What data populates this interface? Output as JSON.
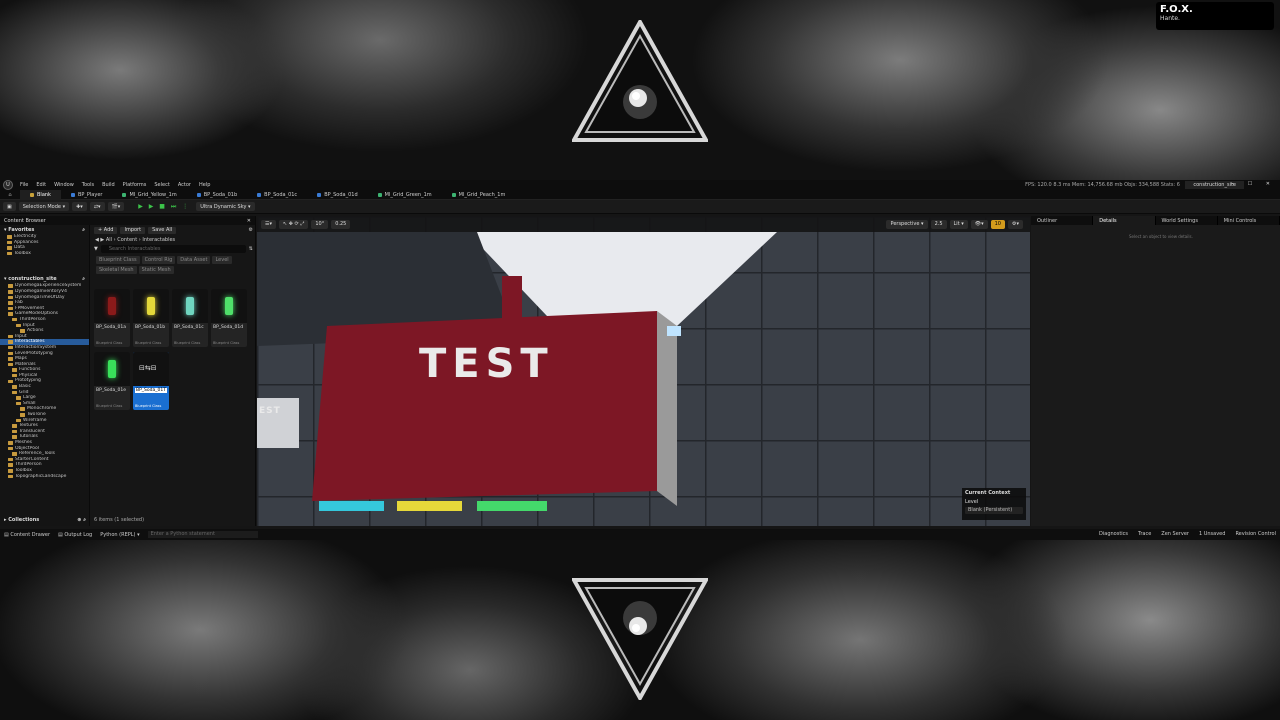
{
  "overlay": {
    "badge_title": "F.O.X.",
    "badge_sub": "Hante."
  },
  "menubar": {
    "items": [
      "File",
      "Edit",
      "Window",
      "Tools",
      "Build",
      "Platforms",
      "Select",
      "Actor",
      "Help"
    ],
    "stats": "FPS: 120.0   8.3 ms   Mem: 14,756.68 mb   Objs: 334,588   Stats: 6",
    "project_tab": "construction_site",
    "window_controls": "–  ☐  ✕"
  },
  "tabs": [
    {
      "label": "Blank",
      "active": true,
      "color": "#c9a23a"
    },
    {
      "label": "BP_Player",
      "active": false,
      "color": "#3a7bd5"
    },
    {
      "label": "MI_Grid_Yellow_1m",
      "active": false,
      "color": "#3cb371"
    },
    {
      "label": "BP_Soda_01b",
      "active": false,
      "color": "#3a7bd5"
    },
    {
      "label": "BP_Soda_01c",
      "active": false,
      "color": "#3a7bd5"
    },
    {
      "label": "BP_Soda_01d",
      "active": false,
      "color": "#3a7bd5"
    },
    {
      "label": "MI_Grid_Green_1m",
      "active": false,
      "color": "#3cb371"
    },
    {
      "label": "MI_Grid_Peach_1m",
      "active": false,
      "color": "#3cb371"
    }
  ],
  "toolbar": {
    "selection_mode": "Selection Mode",
    "quality": "Ultra Dynamic Sky"
  },
  "content_browser": {
    "title": "Content Browser",
    "favorites_label": "Favorites",
    "favorites": [
      "Electricity",
      "Appliances",
      "Data",
      "Toolbox"
    ],
    "project_label": "construction_site",
    "tree": [
      {
        "label": "DynomegaExperienceSystem",
        "indent": 1
      },
      {
        "label": "DynomegaInventoryV4",
        "indent": 1
      },
      {
        "label": "DynomegaTimeOfDay",
        "indent": 1
      },
      {
        "label": "Fab",
        "indent": 1
      },
      {
        "label": "FPMovement",
        "indent": 1
      },
      {
        "label": "GameModeOptions",
        "indent": 1
      },
      {
        "label": "ThirdPerson",
        "indent": 2
      },
      {
        "label": "Input",
        "indent": 3
      },
      {
        "label": "Actions",
        "indent": 4
      },
      {
        "label": "Input",
        "indent": 1
      },
      {
        "label": "Interactables",
        "indent": 1,
        "selected": true
      },
      {
        "label": "InteractionSystem",
        "indent": 1
      },
      {
        "label": "LevelPrototyping",
        "indent": 1
      },
      {
        "label": "Maps",
        "indent": 1
      },
      {
        "label": "Materials",
        "indent": 1
      },
      {
        "label": "Functions",
        "indent": 2
      },
      {
        "label": "Physical",
        "indent": 2
      },
      {
        "label": "Prototyping",
        "indent": 1
      },
      {
        "label": "Basic",
        "indent": 2
      },
      {
        "label": "Grid",
        "indent": 2
      },
      {
        "label": "Large",
        "indent": 3
      },
      {
        "label": "Small",
        "indent": 3
      },
      {
        "label": "Monochrome",
        "indent": 4
      },
      {
        "label": "TwoTone",
        "indent": 4
      },
      {
        "label": "Wireframe",
        "indent": 3
      },
      {
        "label": "Textures",
        "indent": 2
      },
      {
        "label": "Translucent",
        "indent": 2
      },
      {
        "label": "Tutorials",
        "indent": 2
      },
      {
        "label": "Meshes",
        "indent": 1
      },
      {
        "label": "ObjectPool",
        "indent": 1
      },
      {
        "label": "Reference_Tools",
        "indent": 2
      },
      {
        "label": "StarterContent",
        "indent": 1
      },
      {
        "label": "ThirdPerson",
        "indent": 1
      },
      {
        "label": "Toolbox",
        "indent": 1
      },
      {
        "label": "TopographicLandscape",
        "indent": 1
      }
    ],
    "collections_label": "Collections",
    "add_label": "+ Add",
    "import_label": "Import",
    "save_all_label": "Save All",
    "path": [
      "All",
      "Content",
      "Interactables"
    ],
    "search_placeholder": "Search Interactables",
    "filters": [
      "Blueprint Class",
      "Control Rig",
      "Data Asset",
      "Level",
      "Skeletal Mesh",
      "Static Mesh"
    ],
    "assets": [
      {
        "name": "BP_Soda_01a",
        "type": "Blueprint Class",
        "color": "#8b1a1a"
      },
      {
        "name": "BP_Soda_01b",
        "type": "Blueprint Class",
        "color": "#e3d83a"
      },
      {
        "name": "BP_Soda_01c",
        "type": "Blueprint Class",
        "color": "#6fd6c0"
      },
      {
        "name": "BP_Soda_01d",
        "type": "Blueprint Class",
        "color": "#4fe06a"
      },
      {
        "name": "BP_Soda_01e",
        "type": "Blueprint Class",
        "color": "#39e05a"
      },
      {
        "name": "BP_Soda_01T",
        "type": "Blueprint Class",
        "color": "#cccccc",
        "selected": true
      }
    ],
    "status": "6 items (1 selected)"
  },
  "viewport": {
    "perspective": "Perspective",
    "lit": "Lit",
    "snap_angle": "10°",
    "snap_scale": "0.25",
    "camera_speed": "2.5",
    "grid_size": "10",
    "sign_text": "TEST",
    "sign_text_left": "EST",
    "context_title": "Current Context",
    "context_level": "Level",
    "context_value": "Blank (Persistent)"
  },
  "right_panel": {
    "tabs": [
      "Outliner",
      "Details",
      "World Settings",
      "Mini Controls"
    ],
    "message": "Select an object to view details."
  },
  "statusbar": {
    "content_drawer": "Content Drawer",
    "output_log": "Output Log",
    "python": "Python (REPL)",
    "cmd_placeholder": "Enter a Python statement",
    "diagnostics": "Diagnostics",
    "trace": "Trace",
    "zen": "Zen Server",
    "unsaved": "1 Unsaved",
    "revision": "Revision Control"
  }
}
